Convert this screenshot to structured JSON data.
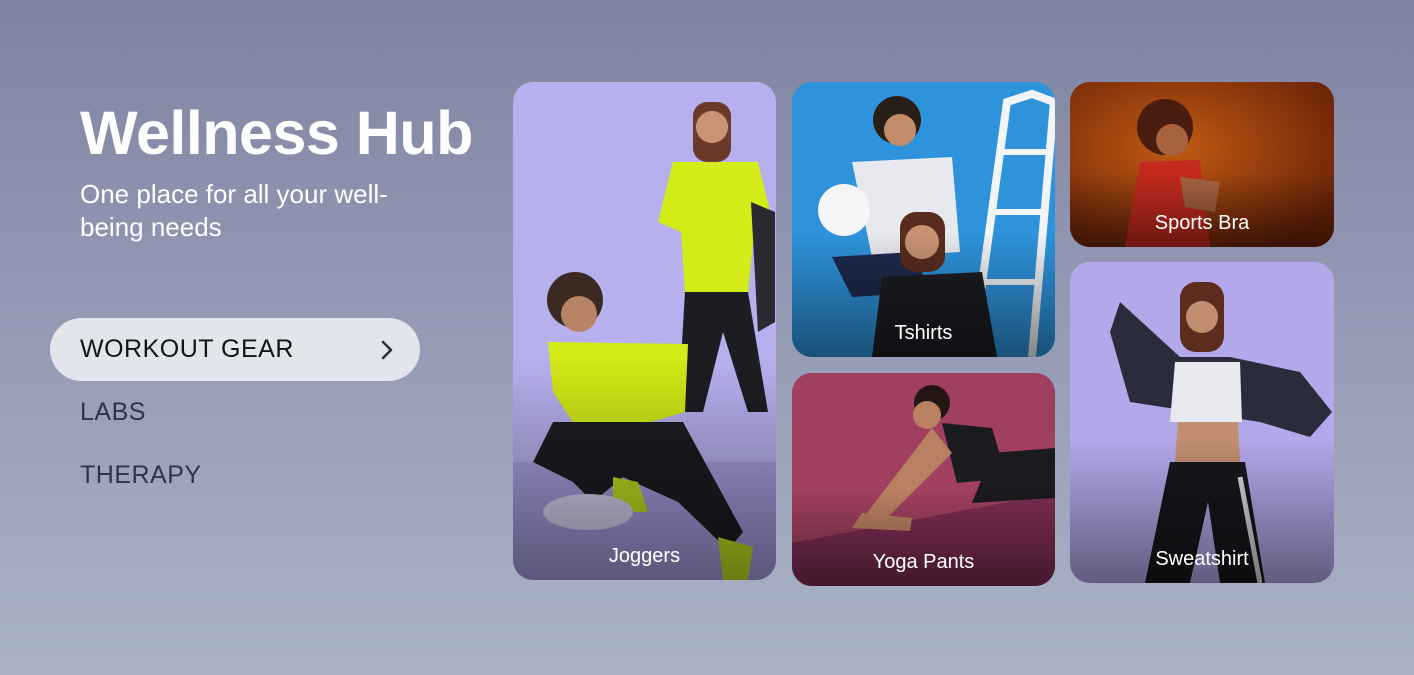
{
  "hero": {
    "title": "Wellness Hub",
    "subtitle": "One place for all your well-being needs"
  },
  "nav": {
    "items": [
      {
        "label": "WORKOUT GEAR",
        "active": true,
        "icon": "chevron-right-icon"
      },
      {
        "label": "LABS",
        "active": false
      },
      {
        "label": "THERAPY",
        "active": false
      }
    ]
  },
  "cards": {
    "joggers": {
      "label": "Joggers",
      "bg": "#b7b0ef"
    },
    "tshirts": {
      "label": "Tshirts",
      "bg": "#2b8fd6"
    },
    "sports_bra": {
      "label": "Sports Bra",
      "bg": "#8c3a12"
    },
    "yoga_pants": {
      "label": "Yoga Pants",
      "bg": "#9a3c5c"
    },
    "sweatshirt": {
      "label": "Sweatshirt",
      "bg": "#b3a9ea"
    }
  },
  "colors": {
    "accent_lime": "#d3eb16",
    "nav_active_bg": "#e3e5ec"
  }
}
